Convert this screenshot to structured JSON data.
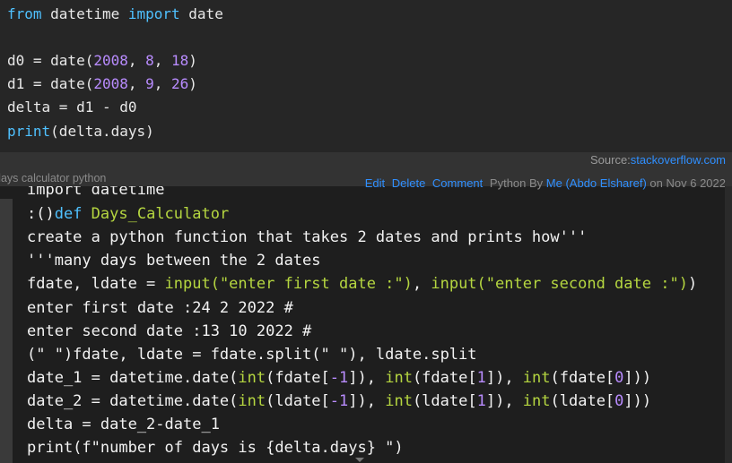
{
  "snippet1": {
    "l1a": "from",
    "l1b": " datetime ",
    "l1c": "import",
    "l1d": " date",
    "l3a": "d0 = date(",
    "l3b": "2008",
    "l3c": ", ",
    "l3d": "8",
    "l3e": ", ",
    "l3f": "18",
    "l3g": ")",
    "l4a": "d1 = date(",
    "l4b": "2008",
    "l4c": ", ",
    "l4d": "9",
    "l4e": ", ",
    "l4f": "26",
    "l4g": ")",
    "l5": "delta = d1 - d0",
    "l6a": "print",
    "l6b": "(delta.days)"
  },
  "meta": {
    "source_label": "Source:",
    "source_link": "stackoverflow.com",
    "page_title": "days calculator python",
    "edit": "Edit",
    "delete": "Delete",
    "comment": "Comment",
    "lang_by": "Python By",
    "author": "Me (Abdo Elsharef)",
    "date": "on Nov 6 2022"
  },
  "snippet2": {
    "l1": "import datetime",
    "l2a": ":()",
    "l2b": "def",
    "l2c": " Days_Calculator",
    "l3": "create a python function that takes 2 dates and prints how'''",
    "l4": "'''many days between the 2 dates",
    "l5a": "fdate, ldate = ",
    "l5b": "input(\"enter first date :\")",
    "l5c": ", ",
    "l5d": "input(\"enter second date :\")",
    "l5e": ")",
    "l6": "enter first date :24 2 2022 #",
    "l7": "enter second date :13 10 2022 #",
    "l8": "(\" \")fdate, ldate = fdate.split(\" \"), ldate.split",
    "l9a": "date_1 = datetime.date(",
    "l9b": "int",
    "l9c": "(fdate[",
    "l9d": "-1",
    "l9e": "]), ",
    "l9f": "int",
    "l9g": "(fdate[",
    "l9h": "1",
    "l9i": "]), ",
    "l9j": "int",
    "l9k": "(fdate[",
    "l9l": "0",
    "l9m": "]))",
    "l10a": "date_2 = datetime.date(",
    "l10b": "int",
    "l10c": "(ldate[",
    "l10d": "-1",
    "l10e": "]), ",
    "l10f": "int",
    "l10g": "(ldate[",
    "l10h": "1",
    "l10i": "]), ",
    "l10j": "int",
    "l10k": "(ldate[",
    "l10l": "0",
    "l10m": "]))",
    "l11": "delta = date_2-date_1",
    "l12": "print(f\"number of days is {delta.days} \")"
  },
  "colors": {
    "keyword": "#4fc1ff",
    "number": "#b98cff",
    "string": "#b5d640",
    "comment": "#7a7a7a",
    "link": "#2f8fff"
  }
}
